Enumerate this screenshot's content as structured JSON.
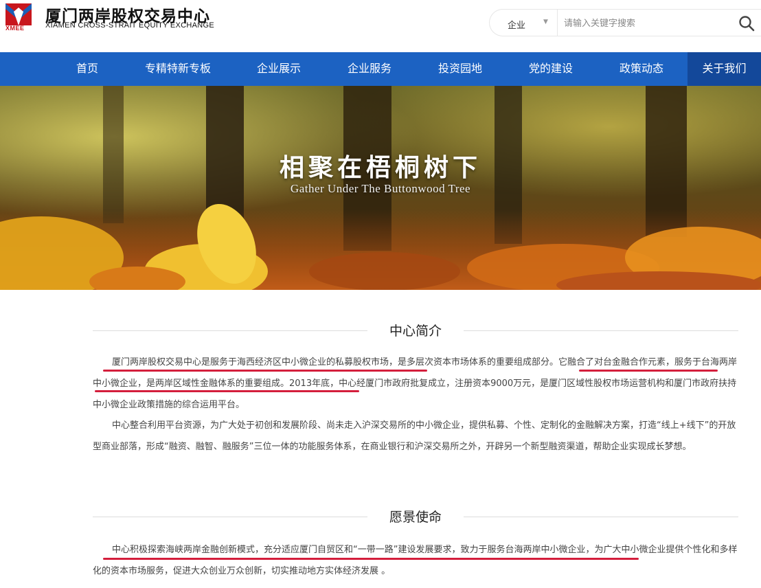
{
  "header": {
    "logo_abbr": "XMEE",
    "brand_cn": "厦门两岸股权交易中心",
    "brand_en": "XIAMEN CROSS-STRAIT EQUITY EXCHANGE",
    "top_cropped_text": "…",
    "search": {
      "category": "企业",
      "placeholder": "请输入关键字搜索"
    }
  },
  "nav": {
    "items": [
      {
        "label": "首页"
      },
      {
        "label": "专精特新专板"
      },
      {
        "label": "企业展示"
      },
      {
        "label": "企业服务"
      },
      {
        "label": "投资园地"
      },
      {
        "label": "党的建设"
      },
      {
        "label": "政策动态"
      },
      {
        "label": "关于我们"
      }
    ],
    "active_index": 7
  },
  "banner": {
    "title": "相聚在梧桐树下",
    "subtitle": "Gather Under The Buttonwood Tree"
  },
  "sections": [
    {
      "title": "中心简介",
      "paragraphs": [
        "厦门两岸股权交易中心是服务于海西经济区中小微企业的私募股权市场，是多层次资本市场体系的重要组成部分。它融合了对台金融合作元素，服务于台海两岸中小微企业，是两岸区域性金融体系的重要组成。2013年底，中心经厦门市政府批复成立，注册资本9000万元，是厦门区域性股权市场运营机构和厦门市政府扶持中小微企业政策措施的综合运用平台。",
        "中心整合利用平台资源，为广大处于初创和发展阶段、尚未走入沪深交易所的中小微企业，提供私募、个性、定制化的金融解决方案，打造“线上+线下”的开放型商业部落，形成“融资、融智、融服务”三位一体的功能服务体系，在商业银行和沪深交易所之外，开辟另一个新型融资渠道，帮助企业实现成长梦想。"
      ]
    },
    {
      "title": "愿景使命",
      "paragraphs": [
        "中心积极探索海峡两岸金融创新模式，充分适应厦门自贸区和“一带一路”建设发展要求，致力于服务台海两岸中小微企业，为广大中小微企业提供个性化和多样化的资本市场服务，促进大众创业万众创新，切实推动地方实体经济发展 。"
      ]
    }
  ],
  "colors": {
    "nav_bg": "#1c62c2",
    "nav_active": "#13489a",
    "brand_red": "#c8161d",
    "annotation_red": "#d41e3c"
  }
}
